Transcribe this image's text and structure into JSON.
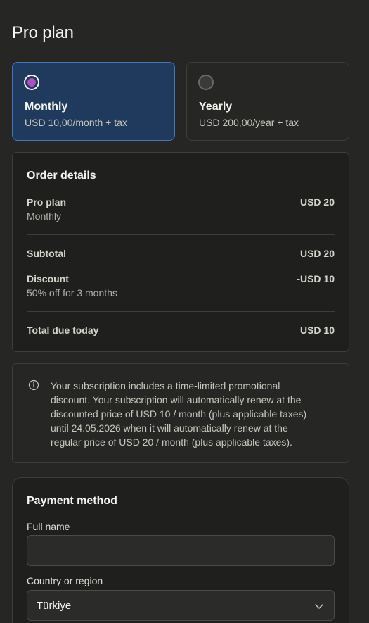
{
  "page": {
    "title": "Pro plan"
  },
  "plans": [
    {
      "name": "Monthly",
      "price": "USD 10,00/month + tax",
      "selected": true
    },
    {
      "name": "Yearly",
      "price": "USD 200,00/year + tax",
      "selected": false
    }
  ],
  "order": {
    "heading": "Order details",
    "item": {
      "label": "Pro plan",
      "sub": "Monthly",
      "value": "USD 20"
    },
    "subtotal": {
      "label": "Subtotal",
      "value": "USD 20"
    },
    "discount": {
      "label": "Discount",
      "sub": "50% off for 3 months",
      "value": "-USD 10"
    },
    "total": {
      "label": "Total due today",
      "value": "USD 10"
    }
  },
  "notice": {
    "icon": "info-icon",
    "lines": [
      "Your subscription includes a time-limited promotional",
      "discount. Your subscription will automatically renew at the",
      "discounted price of USD 10 / month (plus applicable taxes)",
      "until 24.05.2026 when it will automatically renew at the",
      "regular price of USD 20 / month (plus applicable taxes)."
    ]
  },
  "payment": {
    "heading": "Payment method",
    "full_name_label": "Full name",
    "full_name_value": "",
    "country_label": "Country or region",
    "country_value": "Türkiye"
  },
  "colors": {
    "selected_card_bg": "#1f3a5c",
    "selected_card_border": "#3f77b8",
    "radio_fill": "#b04fc4",
    "page_bg": "#262624"
  }
}
